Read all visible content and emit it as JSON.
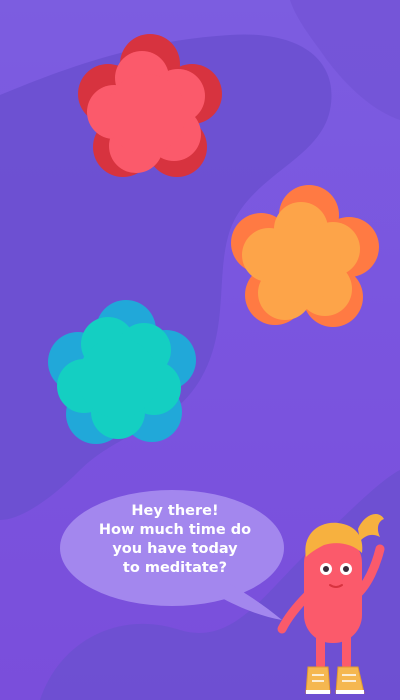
{
  "screen": {
    "background_color": "#7a55df",
    "blob_color": "#6b4fcf"
  },
  "options": [
    {
      "id": "red",
      "color_front": "#fb5a6b",
      "color_back": "#d7333f"
    },
    {
      "id": "orange",
      "color_front": "#fda449",
      "color_back": "#ff7a43"
    },
    {
      "id": "teal",
      "color_front": "#14cfc2",
      "color_back": "#21a8d9"
    }
  ],
  "speech": {
    "lines": [
      "Hey there!",
      "How much time do",
      "you have today",
      "to meditate?"
    ],
    "bubble_color": "#a387ee"
  },
  "mascot": {
    "body_color": "#fb5a6b",
    "hair_color": "#f7b13f",
    "shoe_color": "#f5b750"
  }
}
